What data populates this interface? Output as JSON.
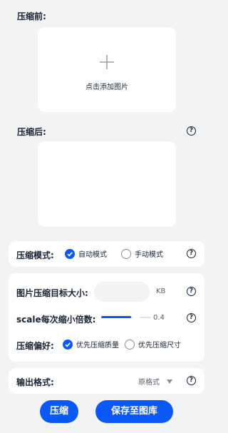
{
  "before": {
    "title": "压缩前:",
    "add_image_label": "点击添加图片"
  },
  "after": {
    "title": "压缩后:"
  },
  "mode": {
    "label": "压缩模式:",
    "options": [
      {
        "label": "自动模式",
        "selected": true
      },
      {
        "label": "手动模式",
        "selected": false
      }
    ]
  },
  "settings": {
    "target_size_label": "图片压缩目标大小:",
    "target_size_value": "",
    "target_size_unit": "KB",
    "scale_label": "scale每次缩小倍数:",
    "scale_value": "0.4",
    "scale_fill_fraction": 0.6,
    "preference_label": "压缩偏好:",
    "preference_options": [
      {
        "label": "优先压缩质量",
        "selected": true
      },
      {
        "label": "优先压缩尺寸",
        "selected": false
      }
    ]
  },
  "output": {
    "label": "输出格式:",
    "selected": "原格式"
  },
  "actions": {
    "compress_label": "压缩",
    "save_label": "保存至图库"
  },
  "colors": {
    "accent": "#0a59f7",
    "background": "#f1f3f5",
    "card": "#ffffff"
  },
  "icons": {
    "help": "question-circle-icon",
    "add": "plus-icon",
    "check": "check-icon",
    "dropdown": "triangle-down-icon"
  }
}
